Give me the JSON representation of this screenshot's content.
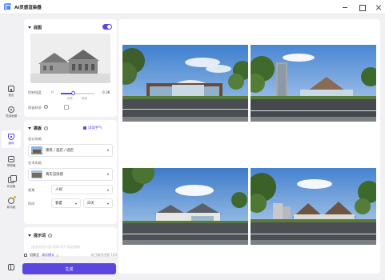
{
  "app": {
    "title": "AI灵感渲染器"
  },
  "rail": {
    "items": [
      {
        "label": "首页",
        "icon": "home-icon"
      },
      {
        "label": "灵感画廊",
        "icon": "compass-icon"
      },
      {
        "label": "建筑",
        "icon": "building-icon"
      },
      {
        "label": "草图编",
        "icon": "sketch-edit-icon"
      },
      {
        "label": "作品集",
        "icon": "portfolio-icon"
      },
      {
        "label": "新功能",
        "icon": "new-feature-icon"
      }
    ]
  },
  "base_card": {
    "title": "底图",
    "enabled": true,
    "control_strength_label": "控制强度",
    "control_strength_value": "0.36",
    "control_strength_level": 0.36,
    "slider_left_tick": "创意",
    "slider_right_tick": "精准",
    "keep_material_label": "保留材质"
  },
  "template_card": {
    "title": "模板",
    "try_link": "试试手气",
    "design_style_label": "设计风格",
    "design_style_value": "建筑 / 酒店 / 酒店",
    "art_style_label": "艺术风格",
    "art_style_value": "真实渲染感",
    "view_label": "视角",
    "view_value": "人视",
    "time_label": "时间",
    "season_value": "春夏",
    "daytime_value": "白天"
  },
  "prompt_card": {
    "title": "提示词",
    "placeholder": "描述画面内容,例如:现代高层建筑"
  },
  "footer": {
    "mode_switch_label": "切换至",
    "mode_value": "调试模式",
    "quota_text": "本日剩余次数 193"
  },
  "generate_button": "生成",
  "colors": {
    "accent": "#5b47e0",
    "background": "#f1f1f4",
    "card": "#ffffff"
  }
}
